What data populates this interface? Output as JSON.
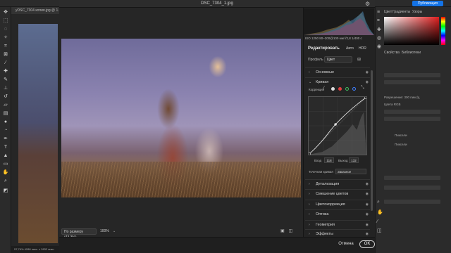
{
  "photoshop": {
    "doc_tab": "yDSC_7304 копия.jpg @ 1...",
    "status": "57,76%   4288 пикс. x 2832 пикс.",
    "publish": "Публикация",
    "right_tabs": [
      "Цвет",
      "Градиенты",
      "Узоры"
    ],
    "right_tabs2": [
      "Свойства",
      "Библиотеки"
    ],
    "right_texts": [
      "Разрешение: 300 пикс/д",
      "Цвета RGB",
      "Пиксели",
      "Пиксели"
    ]
  },
  "acr": {
    "title": "DSC_7304_1.jpg",
    "exif": "ISO 1250   80–200@100 мм   f/2,8   1/400 с",
    "edit_title": "Редактировать",
    "auto": "Авто",
    "hdr": "HDR",
    "profile_label": "Профиль",
    "profile_value": "Цвет",
    "correction_label": "Коррекция",
    "sections_top": [
      {
        "label": "Основные",
        "state": "collapsed"
      },
      {
        "label": "Кривая",
        "state": "expanded"
      }
    ],
    "curve": {
      "input_label": "Вход",
      "input_value": "118",
      "output_label": "Выход",
      "output_value": "132",
      "point_curve_label": "Точечная кривая",
      "point_curve_value": "Заказное"
    },
    "sections_bottom": [
      {
        "label": "Детализация"
      },
      {
        "label": "Смешение цветов"
      },
      {
        "label": "Цветокоррекция"
      },
      {
        "label": "Оптика"
      },
      {
        "label": "Геометрия"
      },
      {
        "label": "Эффекты"
      }
    ],
    "zoom_select": "По размеру (43,3%)",
    "zoom_value": "100%",
    "cancel": "Отмена",
    "ok": "OK"
  },
  "colors": {
    "accent": "#1473e6",
    "curve_line": "#e0e0e0",
    "dot_red": "#e04040",
    "dot_green": "#40c060",
    "dot_blue": "#4080ff"
  },
  "icons": [
    "gear-icon",
    "eye-icon",
    "chevron-right-icon",
    "chevron-down-icon",
    "grid-icon",
    "eyedropper-icon",
    "compare-icon"
  ]
}
